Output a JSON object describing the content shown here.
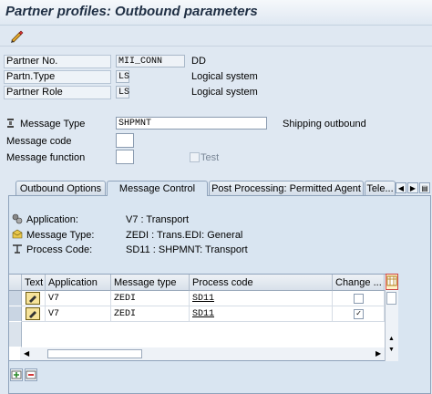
{
  "window": {
    "title": "Partner profiles: Outbound parameters"
  },
  "toolbar": {
    "edit_icon": "pencil-glasses-icon"
  },
  "header_fields": [
    {
      "label": "Partner No.",
      "value": "MII_CONN",
      "desc": "DD"
    },
    {
      "label": "Partn.Type",
      "value": "LS",
      "desc": "Logical system"
    },
    {
      "label": "Partner Role",
      "value": "LS",
      "desc": "Logical system"
    }
  ],
  "message": {
    "type_label": "Message Type",
    "type_value": "SHPMNT",
    "type_desc": "Shipping outbound",
    "code_label": "Message code",
    "code_value": "",
    "function_label": "Message function",
    "function_value": "",
    "test_label": "Test"
  },
  "tabs": [
    {
      "label": "Outbound Options",
      "active": false
    },
    {
      "label": "Message Control",
      "active": true
    },
    {
      "label": "Post Processing: Permitted Agent",
      "active": false
    },
    {
      "label": "Tele...",
      "active": false
    }
  ],
  "info": {
    "application_label": "Application:",
    "application_value": "V7 : Transport",
    "msgtype_label": "Message Type:",
    "msgtype_value": "ZEDI : Trans.EDI: General",
    "proc_label": "Process Code:",
    "proc_value": "SD11 : SHPMNT: Transport"
  },
  "grid": {
    "headers": [
      "Text",
      "Application",
      "Message type",
      "Process code",
      "Change ..."
    ],
    "rows": [
      {
        "application": "V7",
        "message_type": "ZEDI",
        "process_code": "SD11",
        "change": false
      },
      {
        "application": "V7",
        "message_type": "ZEDI",
        "process_code": "SD11",
        "change": true
      }
    ]
  },
  "colors": {
    "background": "#dfe8f2",
    "panel": "#d9e5f1",
    "accent": "#1f2f44"
  }
}
